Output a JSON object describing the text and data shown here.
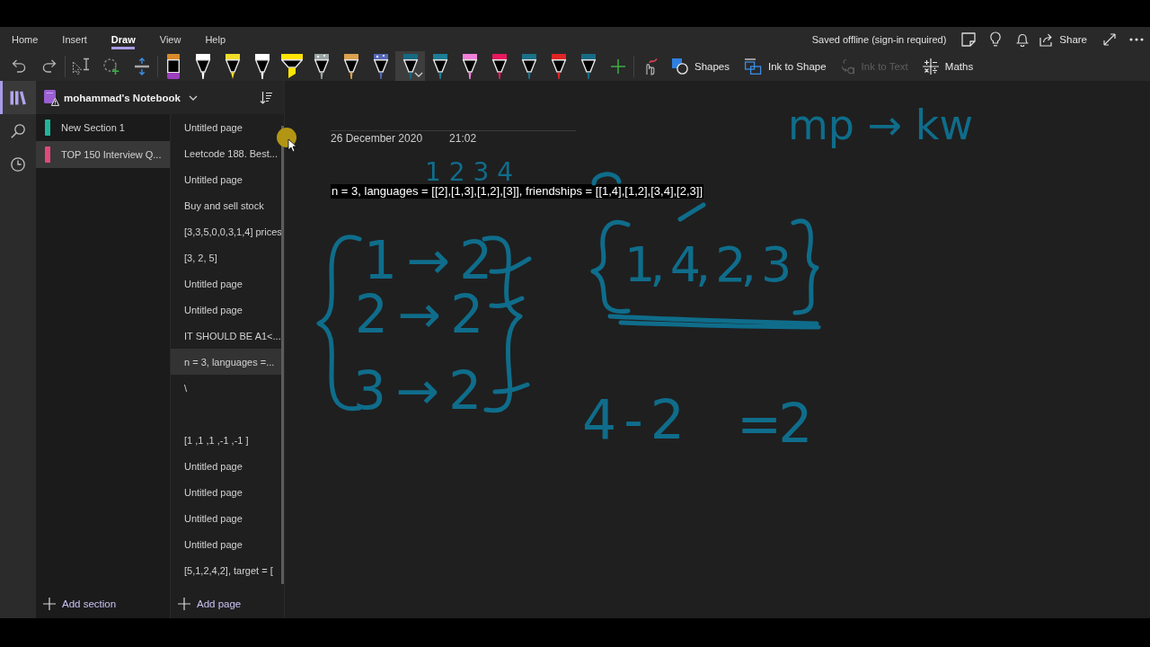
{
  "ribbon": {
    "tabs": [
      {
        "label": "Home",
        "selected": false
      },
      {
        "label": "Insert",
        "selected": false
      },
      {
        "label": "Draw",
        "selected": true
      },
      {
        "label": "View",
        "selected": false
      },
      {
        "label": "Help",
        "selected": false
      }
    ],
    "sync_status": "Saved offline (sign-in required)",
    "share": "Share"
  },
  "toolbar": {
    "pens": [
      {
        "kind": "marker",
        "color": "#9b3fbf",
        "selected": false
      },
      {
        "kind": "pen",
        "color": "#ffffff",
        "selected": false
      },
      {
        "kind": "pencil",
        "color": "#f0dc2a",
        "selected": false
      },
      {
        "kind": "pen",
        "color": "#ffffff",
        "selected": false
      },
      {
        "kind": "highlighter",
        "color": "#ffe500",
        "selected": false
      },
      {
        "kind": "galaxy",
        "color": "#9aa5a5",
        "selected": false
      },
      {
        "kind": "pen",
        "color": "#dba14e",
        "selected": false
      },
      {
        "kind": "galaxy",
        "color": "#5468b8",
        "selected": false
      },
      {
        "kind": "pen",
        "color": "#156a82",
        "selected": true
      },
      {
        "kind": "pen",
        "color": "#1b7d96",
        "selected": false
      },
      {
        "kind": "pen",
        "color": "#f080d8",
        "selected": false
      },
      {
        "kind": "pen",
        "color": "#e8185c",
        "selected": false
      },
      {
        "kind": "pen",
        "color": "#1a7189",
        "selected": false
      },
      {
        "kind": "pen",
        "color": "#e02424",
        "selected": false
      },
      {
        "kind": "pen",
        "color": "#166b84",
        "selected": false
      }
    ],
    "tools": [
      {
        "kind": "shapes",
        "label": "Shapes",
        "disabled": false
      },
      {
        "kind": "ink_to_shape",
        "label": "Ink to Shape",
        "disabled": false
      },
      {
        "kind": "ink_to_text",
        "label": "Ink to Text",
        "disabled": true
      },
      {
        "kind": "maths",
        "label": "Maths",
        "disabled": false
      }
    ]
  },
  "rail": [
    {
      "kind": "notebooks",
      "selected": true
    },
    {
      "kind": "search",
      "selected": false
    },
    {
      "kind": "recent",
      "selected": false
    }
  ],
  "notebook": {
    "title": "mohammad's Notebook",
    "sections": [
      {
        "name": "New Section 1",
        "color": "#1fb59c",
        "selected": false
      },
      {
        "name": "TOP 150 Interview Q...",
        "color": "#e2487c",
        "selected": true
      }
    ],
    "add_section": "Add section"
  },
  "pages": {
    "items": [
      {
        "title": "Untitled page",
        "selected": false
      },
      {
        "title": "Leetcode 188. Best...",
        "selected": false
      },
      {
        "title": "Untitled page",
        "selected": false
      },
      {
        "title": "Buy and sell stock",
        "selected": false
      },
      {
        "title": "[3,3,5,0,0,3,1,4] prices",
        "selected": false
      },
      {
        "title": "[3, 2, 5]",
        "selected": false
      },
      {
        "title": "Untitled page",
        "selected": false
      },
      {
        "title": "Untitled page",
        "selected": false
      },
      {
        "title": "IT SHOULD BE A1<...",
        "selected": false
      },
      {
        "title": "n = 3, languages =...",
        "selected": true
      },
      {
        "title": "\\",
        "selected": false
      },
      {
        "selected": false
      },
      {
        "title": "[1 ,1 ,1 ,-1 ,-1 ]",
        "selected": false
      },
      {
        "title": "Untitled page",
        "selected": false
      },
      {
        "title": "Untitled page",
        "selected": false
      },
      {
        "title": "Untitled page",
        "selected": false
      },
      {
        "title": "Untitled page",
        "selected": false
      },
      {
        "title": "[5,1,2,4,2], target = [",
        "selected": false
      }
    ],
    "add_page": "Add page"
  },
  "page": {
    "date": "26 December 2020",
    "time": "21:02",
    "text": "n = 3, languages = [[2],[1,3],[1,2],[3]], friendships = [[1,4],[1,2],[3,4],[2,3]]",
    "ink": [
      "mp → kw",
      "1 2 3 4",
      "1 → 2",
      "2 → 2",
      "3 → 2",
      "1, 4, 2, 3",
      "4-2",
      "=2"
    ]
  }
}
